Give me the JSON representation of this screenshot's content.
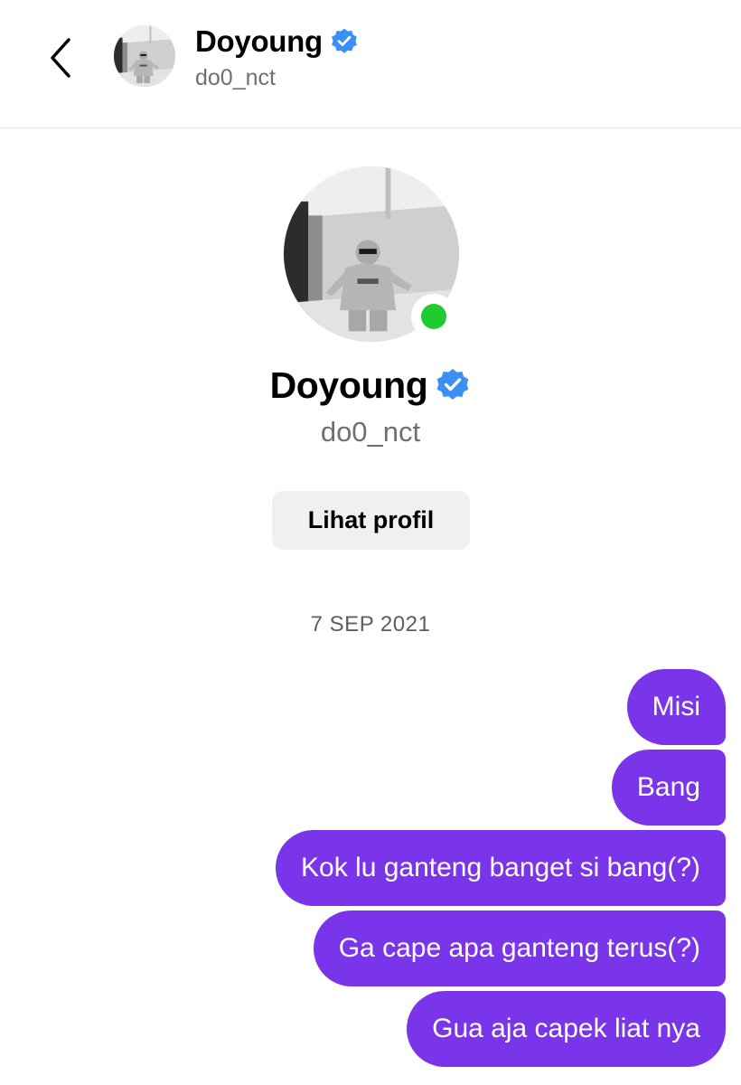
{
  "header": {
    "name": "Doyoung",
    "handle": "do0_nct",
    "back_icon": "chevron-left-icon",
    "verified_icon": "verified-badge-icon"
  },
  "profile": {
    "name": "Doyoung",
    "handle": "do0_nct",
    "online": true,
    "view_profile_label": "Lihat profil"
  },
  "conversation": {
    "date": "7 SEP 2021",
    "messages": [
      "Misi",
      "Bang",
      "Kok lu ganteng banget si bang(?)",
      "Ga cape apa ganteng terus(?)",
      "Gua aja capek liat nya"
    ]
  },
  "colors": {
    "accent": "#7a35ea",
    "verified": "#3b8ff5",
    "online": "#1fcc2f",
    "secondary_text": "#6b6f76"
  }
}
